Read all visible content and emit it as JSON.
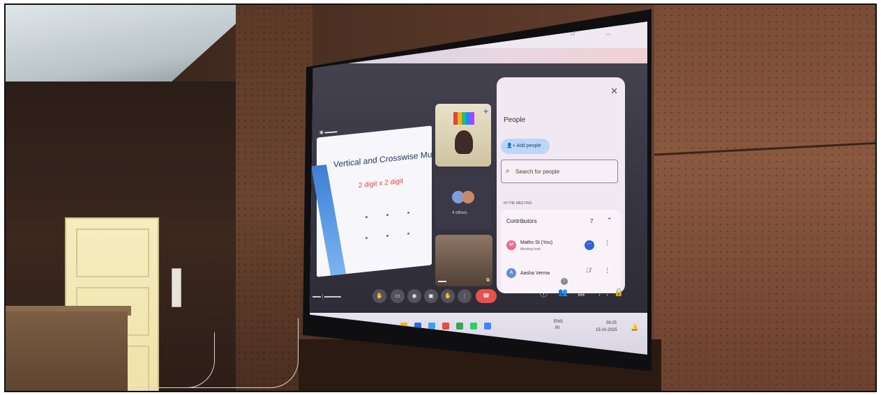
{
  "meet": {
    "slide": {
      "title": "Vertical and Crosswise Multiplication",
      "subtitle": "2 digit x 2 digit"
    },
    "tiles": {
      "others_label": "4 others"
    },
    "people_panel": {
      "title": "People",
      "add_people_label": "Add people",
      "search_placeholder": "Search for people",
      "section_label": "IN THE MEETING",
      "contributors_label": "Contributors",
      "contributors_count": "7",
      "participants": [
        {
          "initial": "M",
          "name": "Maths St (You)",
          "role": "Meeting host",
          "color": "#e96a8a"
        },
        {
          "initial": "A",
          "name": "Aasha Verma",
          "role": "",
          "color": "#6a8ad6"
        }
      ]
    },
    "controls": {
      "people_count": "7"
    },
    "taskbar": {
      "language": "ENG",
      "region": "IN",
      "time": "09:25",
      "date": "15-10-2025"
    }
  },
  "colors": {
    "end_call": "#e8504a",
    "accent_blue": "#2f64d6",
    "panel_bg": "#f1e8f1"
  }
}
